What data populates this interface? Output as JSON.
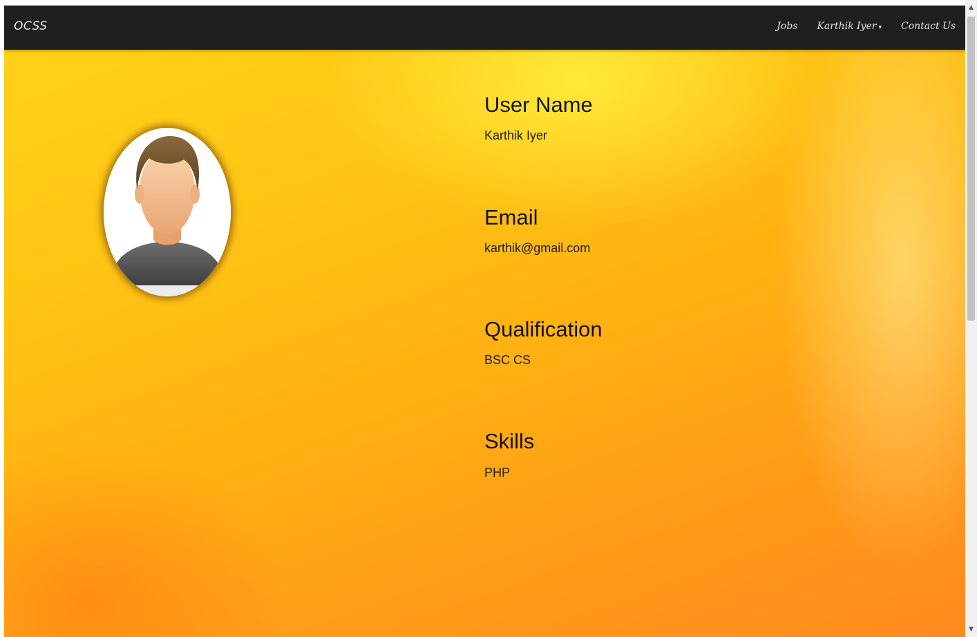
{
  "navbar": {
    "brand": "OCSS",
    "links": {
      "jobs": "Jobs",
      "user": "Karthik Iyer",
      "contact": "Contact Us"
    }
  },
  "profile": {
    "fields": [
      {
        "label": "User Name",
        "value": "Karthik Iyer"
      },
      {
        "label": "Email",
        "value": "karthik@gmail.com"
      },
      {
        "label": "Qualification",
        "value": "BSC CS"
      },
      {
        "label": "Skills",
        "value": "PHP"
      }
    ]
  },
  "icons": {
    "avatar": "user-avatar-icon",
    "caret": "caret-down-icon",
    "scroll_up": "arrow-up-icon",
    "scroll_down": "arrow-down-icon"
  },
  "colors": {
    "navbar": "#1f1f1f",
    "background_top": "#ffd21a",
    "background_bottom": "#ff8a1e"
  }
}
